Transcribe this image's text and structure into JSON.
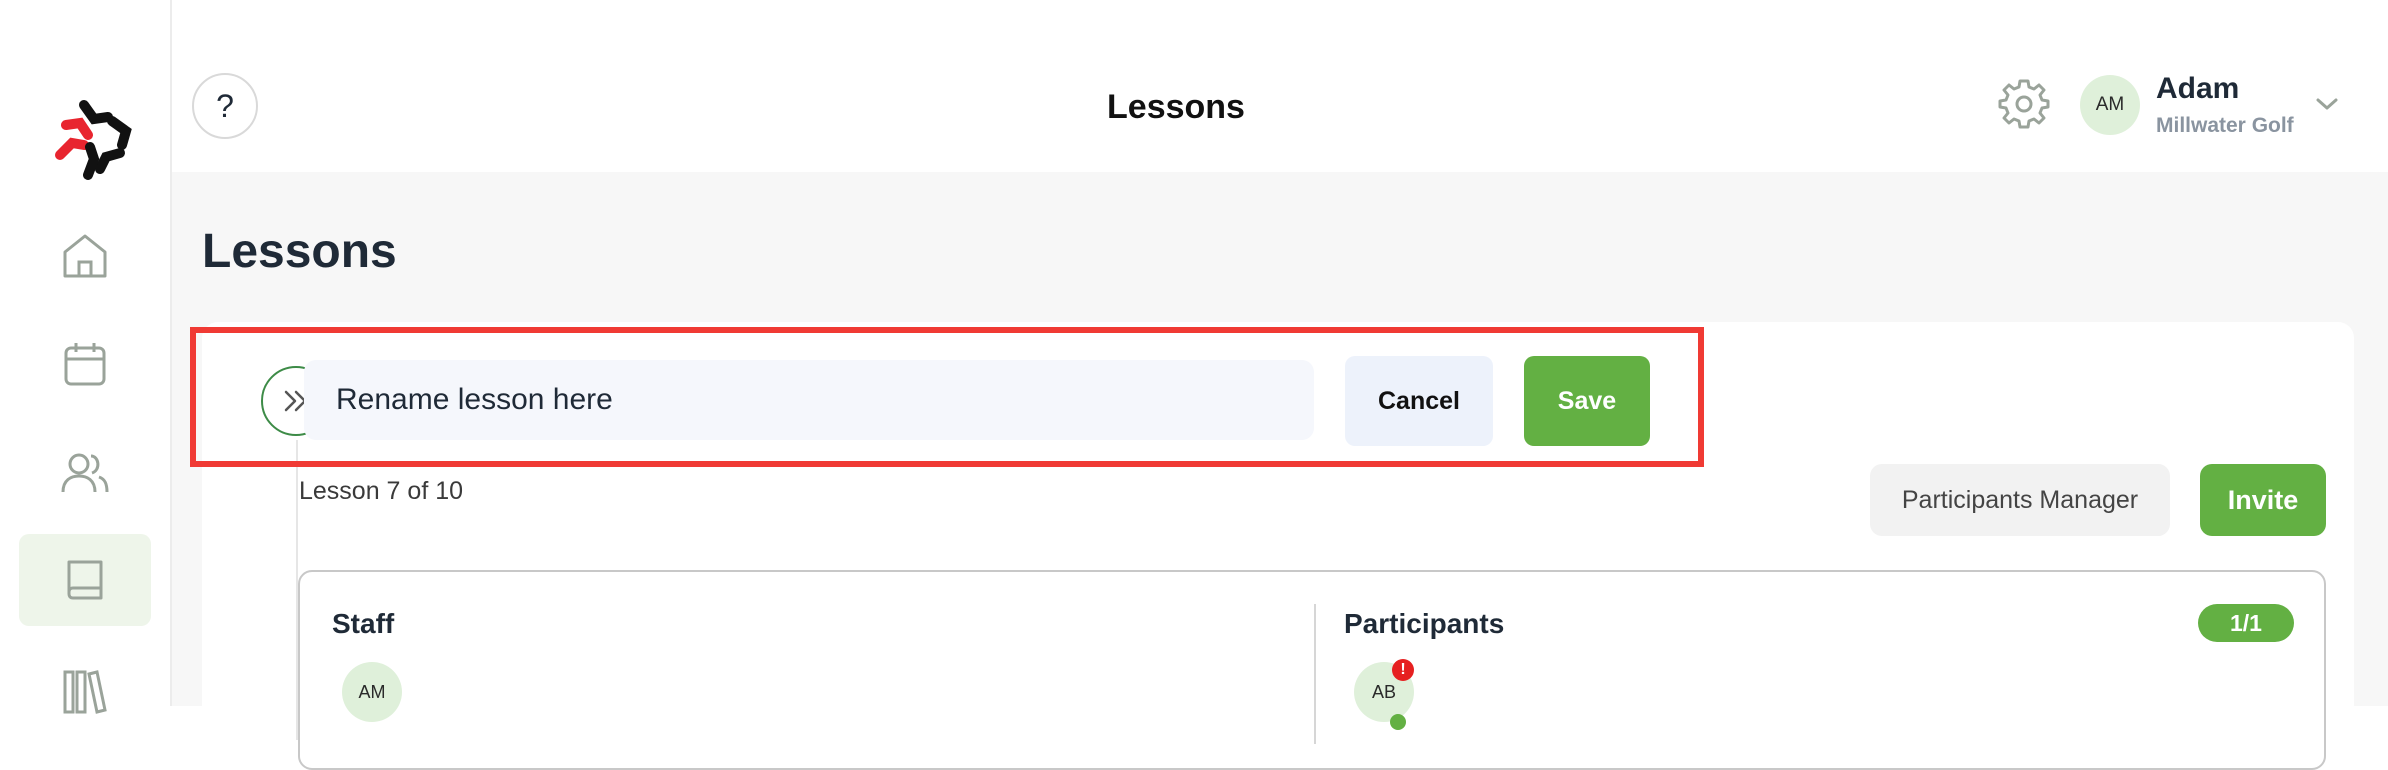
{
  "colors": {
    "accent": "#63b043",
    "highlight": "#f03a34",
    "logo_red": "#e8252f",
    "logo_black": "#111111"
  },
  "sidebar": {
    "items": [
      {
        "icon": "home-icon",
        "active": false
      },
      {
        "icon": "calendar-icon",
        "active": false
      },
      {
        "icon": "users-icon",
        "active": false
      },
      {
        "icon": "book-icon",
        "active": true
      },
      {
        "icon": "library-icon",
        "active": false
      }
    ]
  },
  "header": {
    "help_label": "?",
    "title": "Lessons",
    "user": {
      "initials": "AM",
      "name": "Adam",
      "org": "Millwater Golf"
    }
  },
  "page": {
    "heading": "Lessons"
  },
  "lesson": {
    "rename_placeholder": "Rename lesson here",
    "cancel_label": "Cancel",
    "save_label": "Save",
    "count_text": "Lesson 7 of 10",
    "participants_manager_label": "Participants Manager",
    "invite_label": "Invite"
  },
  "roster": {
    "staff_title": "Staff",
    "participants_title": "Participants",
    "participants_count": "1/1",
    "staff": [
      {
        "initials": "AM"
      }
    ],
    "participants": [
      {
        "initials": "AB",
        "alert": "!"
      }
    ]
  }
}
